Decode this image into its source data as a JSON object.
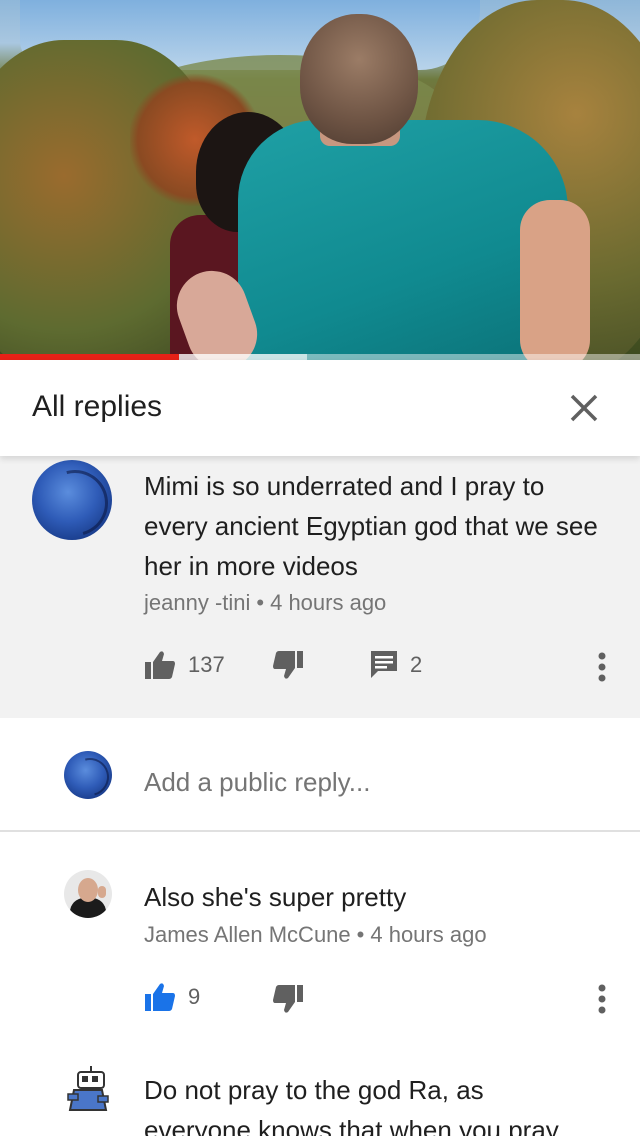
{
  "video": {
    "progress_fraction": 0.28,
    "buffered_fraction": 0.48,
    "progress_color": "#e62117"
  },
  "header": {
    "title": "All replies",
    "close_icon": "close-icon"
  },
  "top_comment": {
    "text": "Mimi is so underrated and I pray to every ancient Egyptian god that we see her in more videos",
    "author": "jeanny -tini",
    "separator": "•",
    "time": "4 hours ago",
    "likes": "137",
    "replies": "2"
  },
  "reply_box": {
    "placeholder": "Add a public reply..."
  },
  "replies": [
    {
      "text": "Also she's super pretty",
      "author": "James Allen McCune",
      "separator": "•",
      "time": "4 hours ago",
      "likes": "9",
      "liked": true
    },
    {
      "text": "Do not pray to the god Ra, as everyone knows that when you pray"
    }
  ],
  "colors": {
    "like_active": "#1a73e8",
    "icon_gray": "#606060",
    "highlight_bg": "#f2f2f2"
  }
}
